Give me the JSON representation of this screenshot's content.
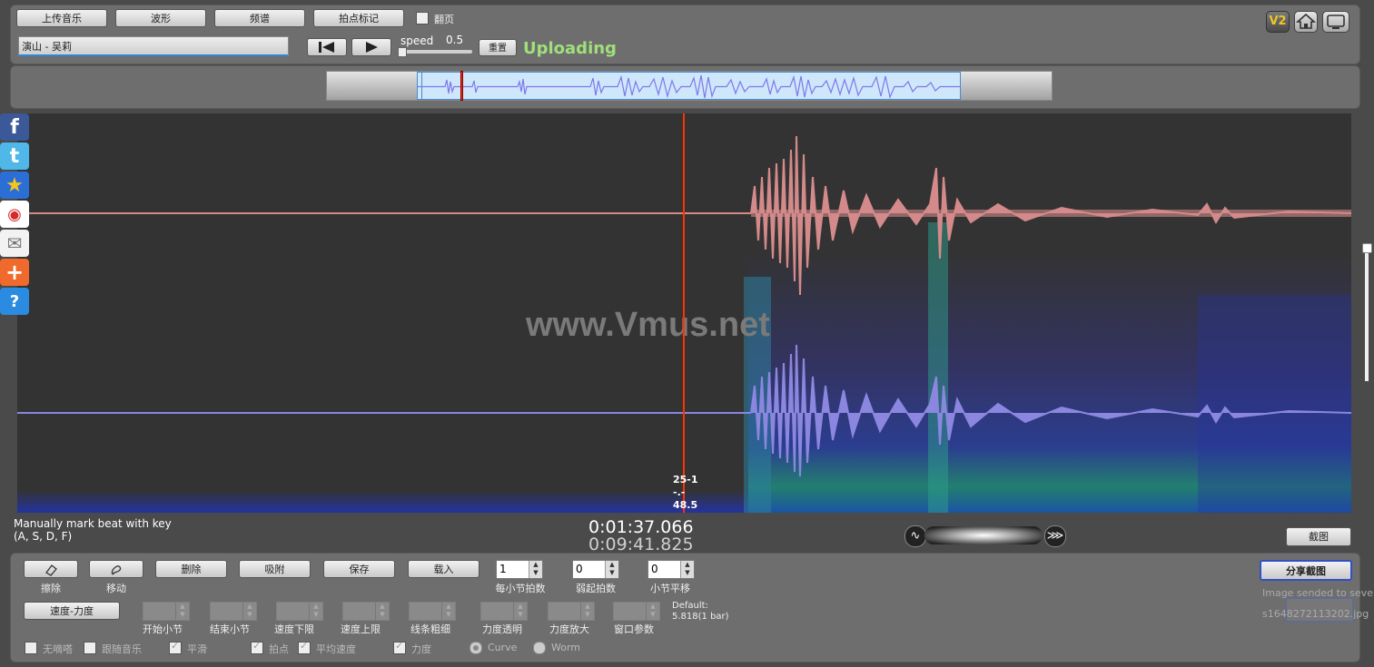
{
  "toolbar": {
    "upload_music": "上传音乐",
    "waveform": "波形",
    "spectrum": "频谱",
    "beat_marking": "拍点标记",
    "page_flip": "翻页",
    "song_name": "演山 - 吴莉",
    "speed_label": "speed",
    "speed_value": "0.5",
    "reset": "重置",
    "status": "Uploading"
  },
  "top_right": {
    "v2": "V2"
  },
  "main": {
    "watermark": "www.Vmus.net",
    "cursor_bar_beat": "25-1",
    "cursor_sep": "-.-",
    "cursor_value": "48.5"
  },
  "info": {
    "hint_line1": "Manually mark beat with key",
    "hint_line2": "(A, S, D, F)",
    "time_current": "0:01:37.066",
    "time_total": "0:09:41.825",
    "screenshot": "截图"
  },
  "controls": {
    "erase": "擦除",
    "move": "移动",
    "delete": "删除",
    "snap": "吸附",
    "save": "保存",
    "load": "载入",
    "beats_per_bar_value": "1",
    "beats_per_bar_label": "每小节拍数",
    "pickup_value": "0",
    "pickup_label": "弱起拍数",
    "bar_shift_value": "0",
    "bar_shift_label": "小节平移",
    "speed_force": "速度-力度",
    "start_bar": "开始小节",
    "end_bar": "结束小节",
    "speed_lower": "速度下限",
    "speed_upper": "速度上限",
    "line_width": "线条粗细",
    "force_transparency": "力度透明",
    "force_zoom": "力度放大",
    "window_param": "窗口参数",
    "default_line1": "Default:",
    "default_line2": "5.818(1 bar)",
    "no_metronome": "无嘀嗒",
    "follow_music": "跟随音乐",
    "smooth": "平滑",
    "beat_point": "拍点",
    "avg_speed": "平均速度",
    "force": "力度",
    "curve": "Curve",
    "worm": "Worm"
  },
  "share": {
    "share_screenshot": "分享截图",
    "sent_msg": "Image sended to sever",
    "file_name": "s1648272113202.jpg"
  },
  "colors": {
    "upper_wave": "#d48a8a",
    "lower_wave": "#8b86e0",
    "cursor": "#ff3300",
    "status": "#9fe07a",
    "spectrum_bg": "#333333"
  }
}
